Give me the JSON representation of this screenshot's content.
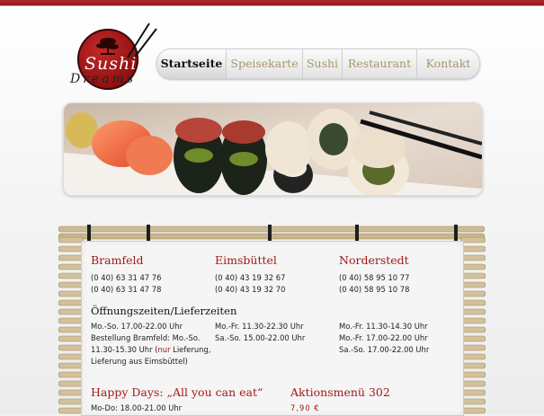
{
  "colors": {
    "brand_red": "#a01a1a",
    "nav_text": "#a8956b",
    "active_tab": "#111111"
  },
  "logo": {
    "line1": "Sushi",
    "line2": "Dreams"
  },
  "nav": {
    "tabs": [
      {
        "label": "Startseite",
        "active": true
      },
      {
        "label": "Speisekarte",
        "active": false
      },
      {
        "label": "Sushi",
        "active": false
      },
      {
        "label": "Restaurant",
        "active": false
      },
      {
        "label": "Kontakt",
        "active": false
      }
    ]
  },
  "locations": [
    {
      "name": "Bramfeld",
      "phone1": "(0 40) 63 31 47 76",
      "phone2": "(0 40) 63 31 47 78"
    },
    {
      "name": "Eimsbüttel",
      "phone1": "(0 40) 43 19 32 67",
      "phone2": "(0 40) 43 19 32 70"
    },
    {
      "name": "Norderstedt",
      "phone1": "(0 40) 58 95 10 77",
      "phone2": "(0 40) 58 95 10 78"
    }
  ],
  "hours": {
    "title": "Öffnungszeiten/Lieferzeiten",
    "bramfeld": {
      "line1": "Mo.-So. 17.00-22.00 Uhr",
      "line2": "Bestellung Bramfeld: Mo.-So.",
      "line3_a": "11.30-15.30 Uhr (",
      "line3_highlight": "nur",
      "line3_b": " Lieferung,",
      "line4": "Lieferung aus Eimsbüttel)"
    },
    "eimsbuettel": {
      "line1": "Mo.-Fr. 11.30-22.30 Uhr",
      "line2": "Sa.-So. 15.00-22.00 Uhr"
    },
    "norderstedt": {
      "line1": "Mo.-Fr. 11.30-14.30 Uhr",
      "line2": "Mo.-Fr. 17.00-22.00 Uhr",
      "line3": "Sa.-So. 17.00-22.00 Uhr"
    }
  },
  "promos": {
    "happy_days_title": "Happy Days: „All you can eat“",
    "happy_days_line": "Mo-Do: 18.00-21.00 Uhr",
    "menu_title": "Aktionsmenü 302",
    "menu_price": "7,90 €"
  }
}
